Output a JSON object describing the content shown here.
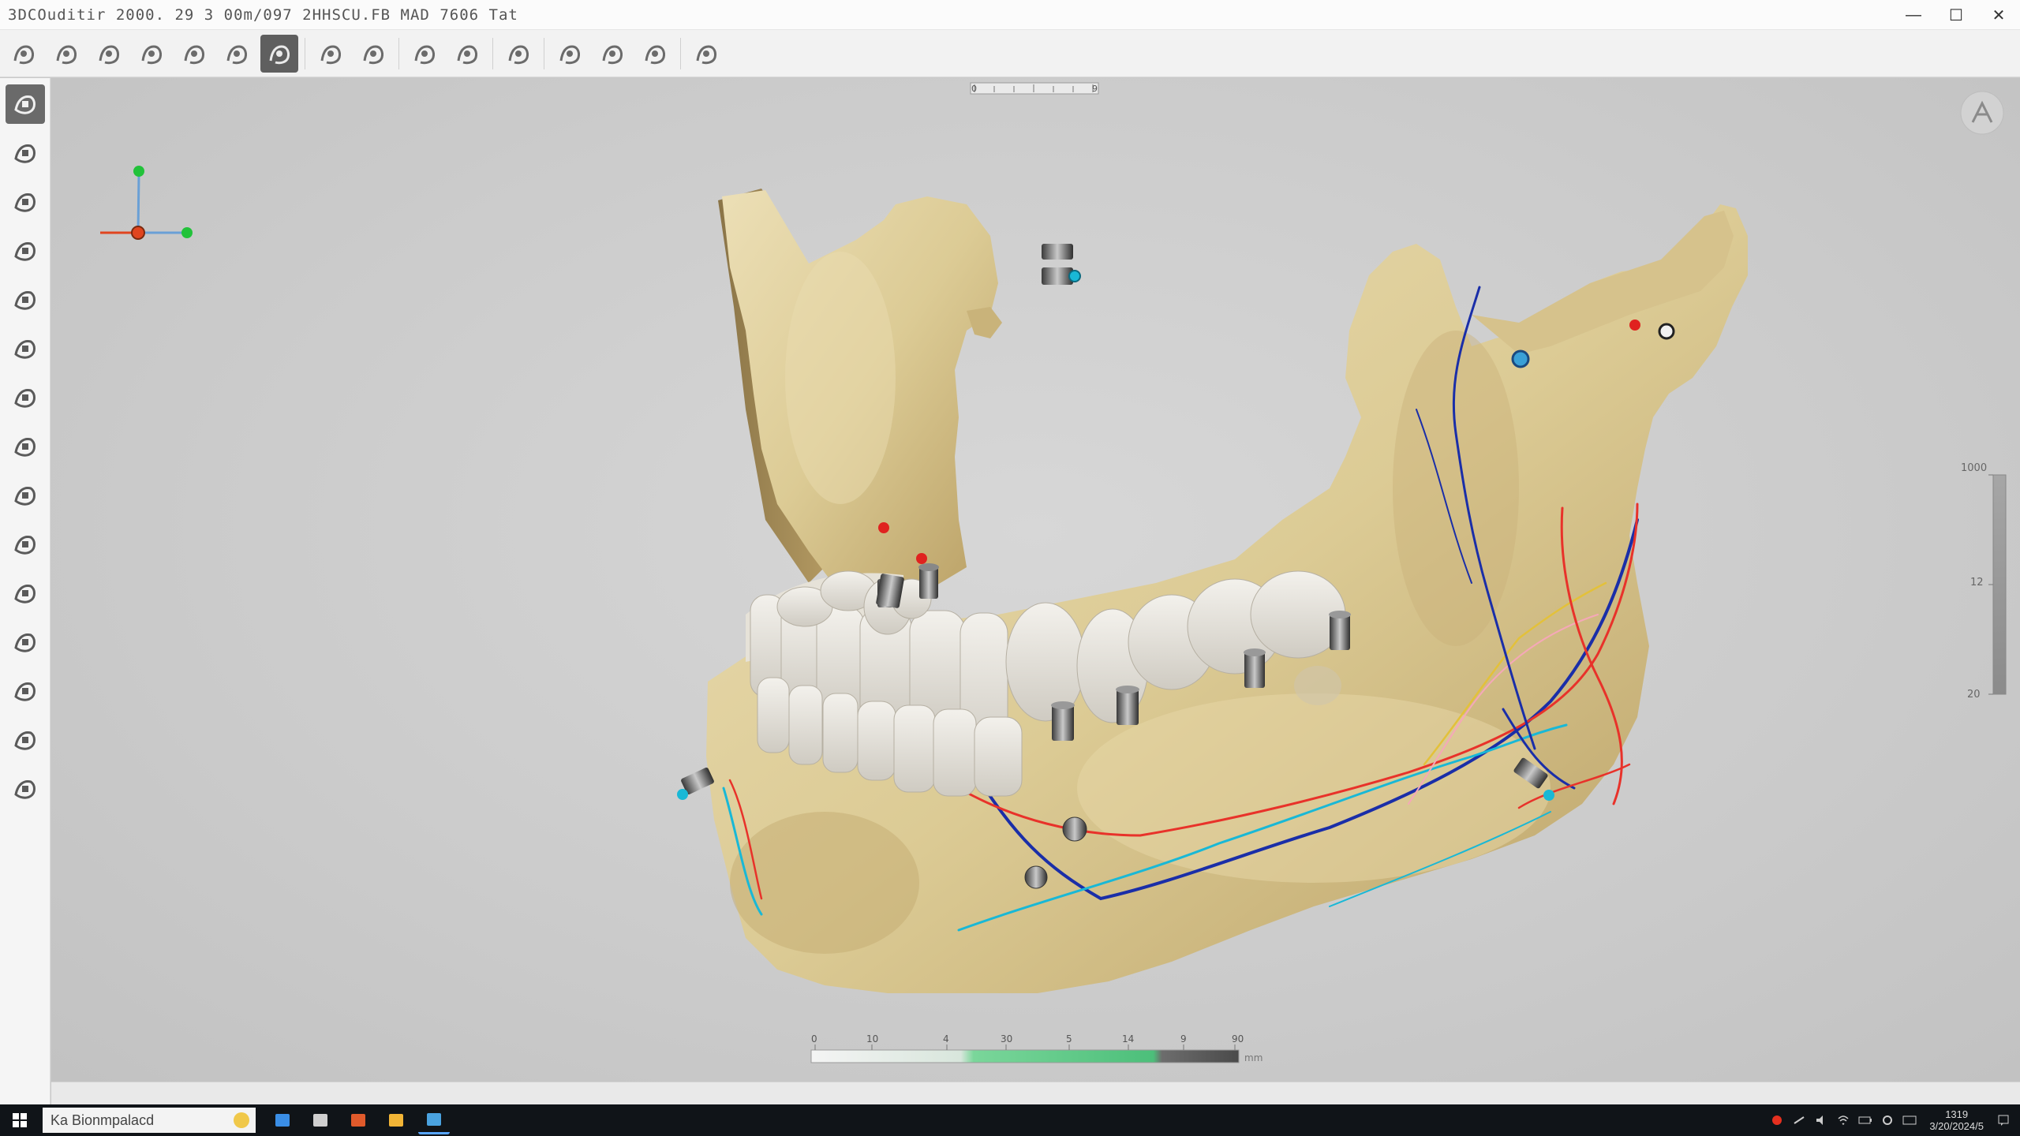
{
  "window": {
    "title": "3DCOuditir 2000. 29 3 00m/097 2HHSCU.FB MAD 7606 Tat",
    "minimize": "—",
    "maximize": "☐",
    "close": "✕"
  },
  "toolbar": {
    "groups": [
      [
        "grid-icon",
        "layers-icon",
        "bar-chart-icon",
        "tooth-side-icon",
        "scalpel-icon",
        "implant-icon",
        "lock-icon"
      ],
      [
        "jaw-icon",
        "curve-icon"
      ],
      [
        "arch-icon",
        "drill-icon"
      ],
      [
        "shield-icon"
      ],
      [
        "nerve-icon",
        "bone-block-icon",
        "crown-icon"
      ],
      [
        "export-icon"
      ]
    ],
    "active_index": 6
  },
  "sidebar": {
    "tools": [
      "select-tool-icon",
      "measure-tool-icon",
      "tooth-tool-icon",
      "music-note-icon",
      "mandible-tool-icon",
      "wand-tool-icon",
      "eraser-tool-icon",
      "crown-tool-icon",
      "note-tool-icon",
      "rotate-tool-icon",
      "hand-tool-icon",
      "paint-tool-icon",
      "drill-tool-icon",
      "pin-tool-icon",
      "settings-tool-icon"
    ],
    "active_index": 0
  },
  "viewport": {
    "ruler_top": {
      "ticks": [
        "0",
        "9"
      ]
    },
    "density_scale": {
      "top": "1000",
      "mid": "12",
      "bottom": "20"
    },
    "color_scale": {
      "ticks": [
        "0",
        "10",
        "4",
        "30",
        "5",
        "14",
        "9",
        "90"
      ],
      "unit": "mm"
    },
    "colors": {
      "nerve_blue": "#1a2ea8",
      "nerve_cyan": "#19b8d6",
      "nerve_red": "#e8322a",
      "nerve_yellow": "#e3c13a",
      "axis_green": "#22c23a",
      "axis_red": "#e0451f"
    },
    "view_button": "compass-icon"
  },
  "taskbar": {
    "search_text": "Ka Bionmpalacd",
    "apps": [
      "file-explorer-icon",
      "task-view-icon",
      "office-icon",
      "folder-icon",
      "edge-icon"
    ],
    "active_app": 4,
    "clock_time": "1319",
    "clock_date": "3/20/2024/5"
  }
}
